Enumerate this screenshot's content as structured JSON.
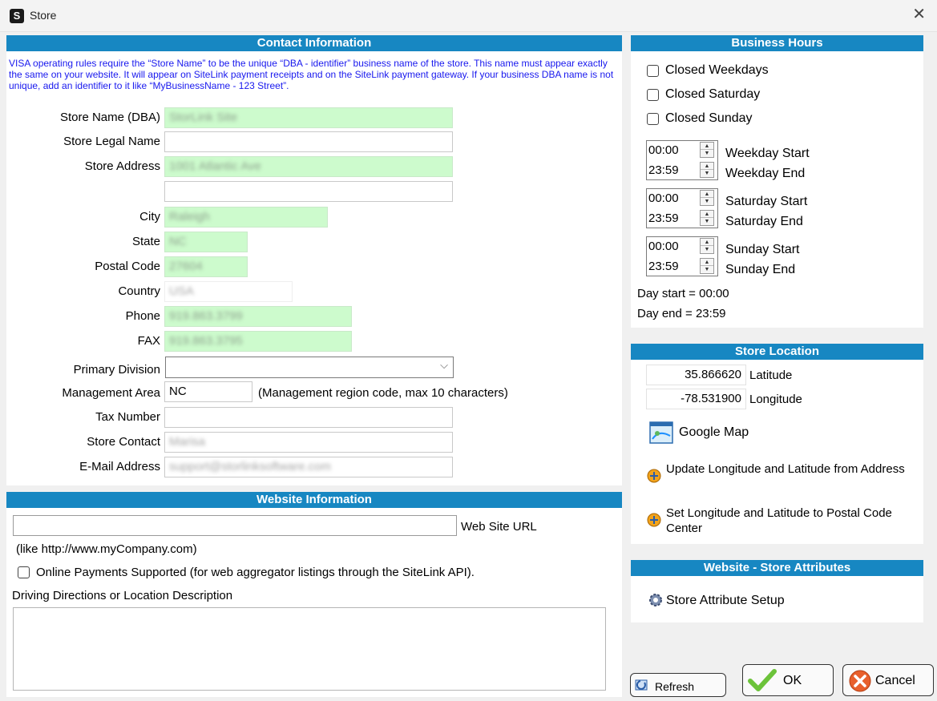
{
  "window": {
    "title": "Store",
    "app_icon_letter": "S"
  },
  "contact": {
    "header": "Contact Information",
    "notice": "VISA operating rules require the “Store Name” to be the unique “DBA - identifier” business name of the store. This name must appear exactly the same on your website. It will appear on SiteLink payment receipts and on the SiteLink payment gateway. If your business DBA name is not unique, add an identifier to it like “MyBusinessName - 123 Street”.",
    "labels": {
      "store_name": "Store Name (DBA)",
      "legal_name": "Store Legal Name",
      "address": "Store Address",
      "city": "City",
      "state": "State",
      "postal": "Postal Code",
      "country": "Country",
      "phone": "Phone",
      "fax": "FAX",
      "division": "Primary Division",
      "mgmt_area": "Management Area",
      "tax": "Tax Number",
      "contact": "Store Contact",
      "email": "E-Mail Address"
    },
    "values": {
      "store_name": "StorLink Site",
      "legal_name": "",
      "address1": "1001 Atlantic Ave",
      "address2": "",
      "city": "Raleigh",
      "state": "NC",
      "postal": "27604",
      "country": "USA",
      "phone": "919.863.3799",
      "fax": "919.863.3795",
      "division": "",
      "mgmt_area": "NC",
      "tax": "",
      "contact": "Marisa",
      "email": "support@storlinksoftware.com"
    },
    "mgmt_hint": "(Management region code,  max 10  characters)"
  },
  "website": {
    "header": "Website Information",
    "url_value": "",
    "url_label": "Web Site URL",
    "url_hint": "(like  http://www.myCompany.com)",
    "online_payments": "Online Payments Supported  (for web aggregator listings through the SiteLink API).",
    "directions_label": "Driving Directions or Location Description",
    "directions_value": ""
  },
  "hours": {
    "header": "Business Hours",
    "closed_weekdays": "Closed Weekdays",
    "closed_saturday": "Closed Saturday",
    "closed_sunday": "Closed Sunday",
    "weekday_start_time": "00:00",
    "weekday_end_time": "23:59",
    "saturday_start_time": "00:00",
    "saturday_end_time": "23:59",
    "sunday_start_time": "00:00",
    "sunday_end_time": "23:59",
    "weekday_start": "Weekday Start",
    "weekday_end": "Weekday End",
    "saturday_start": "Saturday Start",
    "saturday_end": "Saturday End",
    "sunday_start": "Sunday Start",
    "sunday_end": "Sunday End",
    "day_start": "Day start = 00:00",
    "day_end": "Day end = 23:59"
  },
  "location": {
    "header": "Store Location",
    "latitude": "35.866620",
    "latitude_label": "Latitude",
    "longitude": "-78.531900",
    "longitude_label": "Longitude",
    "google_map": "Google Map",
    "update_from_address": "Update Longitude and Latitude from Address",
    "set_postal_center": "Set Longitude and Latitude to Postal Code Center"
  },
  "attributes": {
    "header": "Website - Store Attributes",
    "setup": "Store Attribute Setup"
  },
  "buttons": {
    "refresh": "Refresh",
    "ok": "OK",
    "cancel": "Cancel"
  },
  "colors": {
    "header_blue": "#1787c2",
    "notice_blue": "#1818ee",
    "highlight_green": "#cdfbcd"
  }
}
